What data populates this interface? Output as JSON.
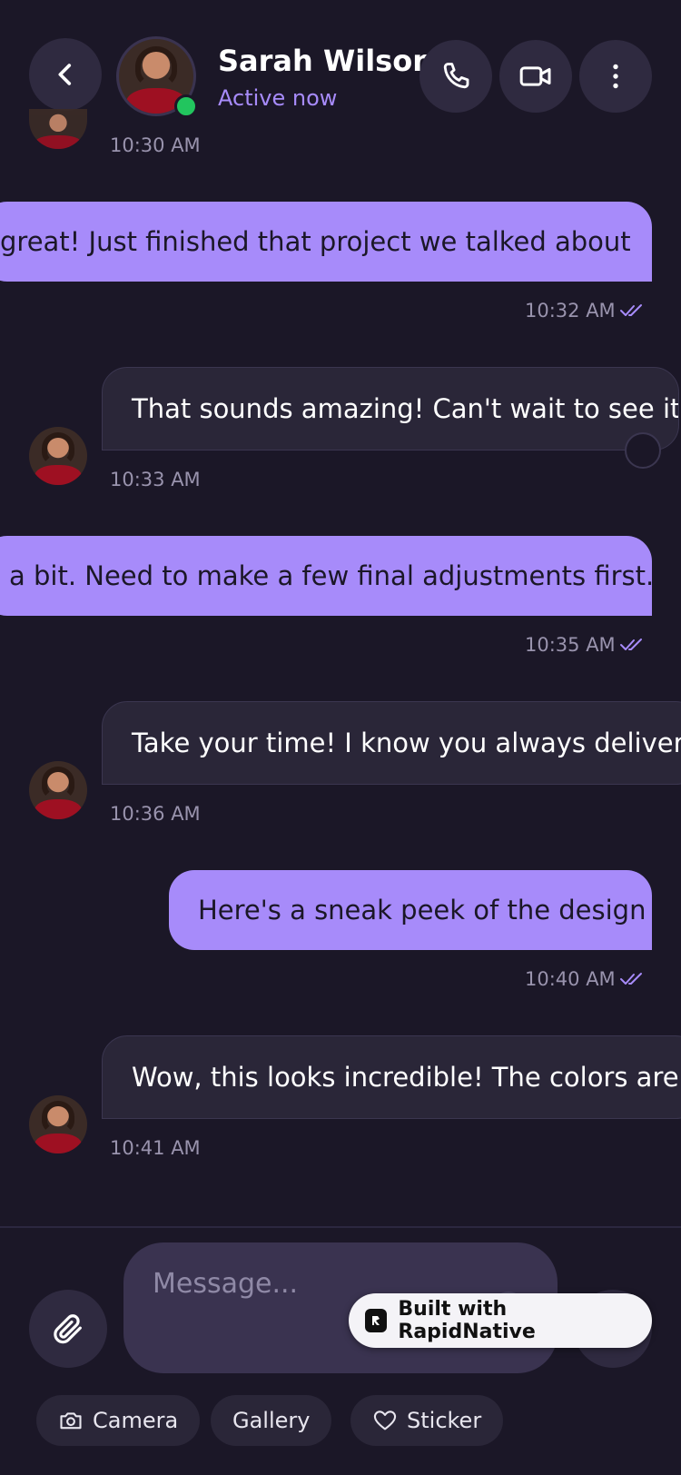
{
  "header": {
    "name": "Sarah Wilson",
    "status": "Active now"
  },
  "messages": [
    {
      "time": "10:30 AM"
    },
    {
      "text": "great! Just finished that project we talked about",
      "time": "10:32 AM"
    },
    {
      "text": "That sounds amazing! Can't wait to see it",
      "time": "10:33 AM"
    },
    {
      "text": "a bit. Need to make a few final adjustments first.",
      "time": "10:35 AM"
    },
    {
      "text": "Take your time! I know you always deliver q",
      "time": "10:36 AM"
    },
    {
      "text": "Here's a sneak peek of the design",
      "time": "10:40 AM"
    },
    {
      "text": "Wow, this looks incredible! The colors are p",
      "time": "10:41 AM"
    }
  ],
  "composer": {
    "placeholder": "Message...",
    "badge": "Built with RapidNative"
  },
  "quick_actions": {
    "camera": "Camera",
    "gallery": "Gallery",
    "sticker": "Sticker"
  },
  "colors": {
    "background": "#1b1727",
    "accent": "#a78bfa",
    "online": "#22c55e"
  }
}
